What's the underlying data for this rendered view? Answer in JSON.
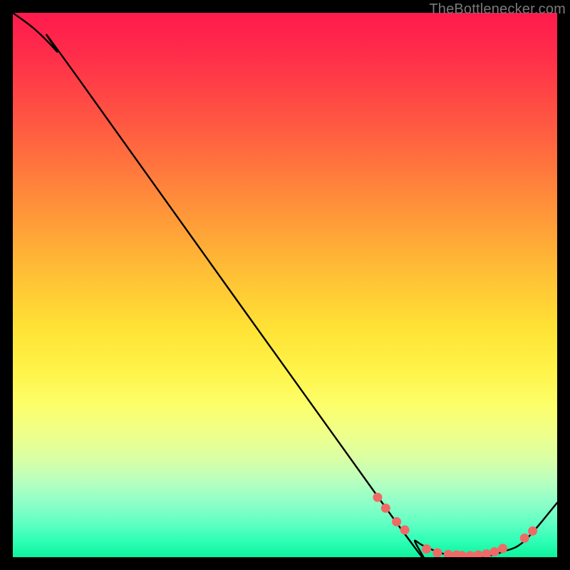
{
  "watermark": "TheBottlenecker.com",
  "chart_data": {
    "type": "line",
    "title": "",
    "xlabel": "",
    "ylabel": "",
    "xlim": [
      0,
      100
    ],
    "ylim": [
      0,
      100
    ],
    "grid": false,
    "series": [
      {
        "name": "curve",
        "color": "#000000",
        "x": [
          0,
          4,
          8,
          12,
          70,
          74,
          78,
          82,
          86,
          90,
          94,
          100
        ],
        "y": [
          100,
          97,
          93,
          88,
          7,
          3,
          1,
          0,
          0,
          1,
          3,
          10
        ]
      }
    ],
    "markers": {
      "color": "#ef6a66",
      "points_x": [
        67,
        68.5,
        70.5,
        72,
        76,
        78,
        80,
        81.5,
        82.5,
        84,
        85.5,
        87,
        88.5,
        90,
        94,
        95.5
      ],
      "points_y": [
        11,
        9,
        6.5,
        5,
        1.5,
        0.8,
        0.5,
        0.4,
        0.3,
        0.3,
        0.4,
        0.6,
        1.0,
        1.6,
        3.5,
        4.8
      ]
    },
    "background_gradient": {
      "stops": [
        {
          "pos": 0,
          "color": "#ff1a4d"
        },
        {
          "pos": 35,
          "color": "#ff8f3a"
        },
        {
          "pos": 58,
          "color": "#ffe235"
        },
        {
          "pos": 82,
          "color": "#d9ffa5"
        },
        {
          "pos": 100,
          "color": "#0df29e"
        }
      ]
    }
  }
}
